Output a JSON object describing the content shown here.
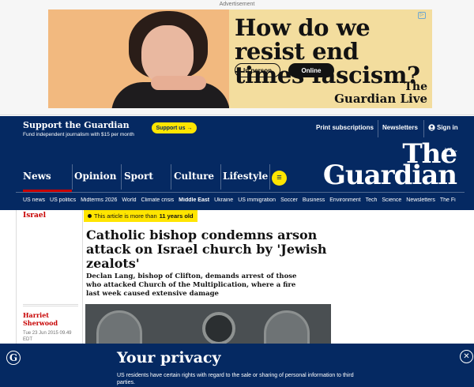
{
  "ad": {
    "label": "Advertisement",
    "headline": "How do we resist end times fascism?",
    "pill_in_person": "In person",
    "pill_online": "Online",
    "brand_line1": "The",
    "brand_line2": "Guardian Live",
    "adchoice_glyph": "▷"
  },
  "support": {
    "title": "Support the Guardian",
    "subtitle": "Fund independent journalism with $15 per month",
    "button": "Support us",
    "button_arrow": "→",
    "print_subscriptions": "Print subscriptions",
    "newsletters": "Newsletters",
    "sign_in": "Sign in"
  },
  "masthead": {
    "edition": "US",
    "logo_line1": "The",
    "logo_line2": "Guardian",
    "pillars": [
      "News",
      "Opinion",
      "Sport",
      "Culture",
      "Lifestyle"
    ],
    "menu_glyph": "≡"
  },
  "subnav": [
    "US news",
    "US politics",
    "Midterms 2026",
    "World",
    "Climate crisis",
    "Middle East",
    "Ukraine",
    "US immigration",
    "Soccer",
    "Business",
    "Environment",
    "Tech",
    "Science",
    "Newsletters",
    "The Fi"
  ],
  "subnav_active": "Middle East",
  "article": {
    "section": "Israel",
    "age_prefix": "This article is more than",
    "age_value": "11 years old",
    "headline": "Catholic bishop condemns arson attack on Israel church by 'Jewish zealots'",
    "standfirst": "Declan Lang, bishop of Clifton, demands arrest of those who attacked Church of the Multiplication, where a fire last week caused extensive damage",
    "author_line1": "Harriet",
    "author_line2": "Sherwood",
    "date_line1": "Tue 23 Jun 2015 09.49",
    "date_line2": "EDT"
  },
  "privacy": {
    "logo_glyph": "G",
    "title": "Your privacy",
    "text": "US residents have certain rights with regard to the sale or sharing of personal information to third parties.",
    "close_glyph": "✕"
  },
  "colors": {
    "brand": "#052962",
    "news_red": "#c70000",
    "highlight": "#ffe500"
  }
}
